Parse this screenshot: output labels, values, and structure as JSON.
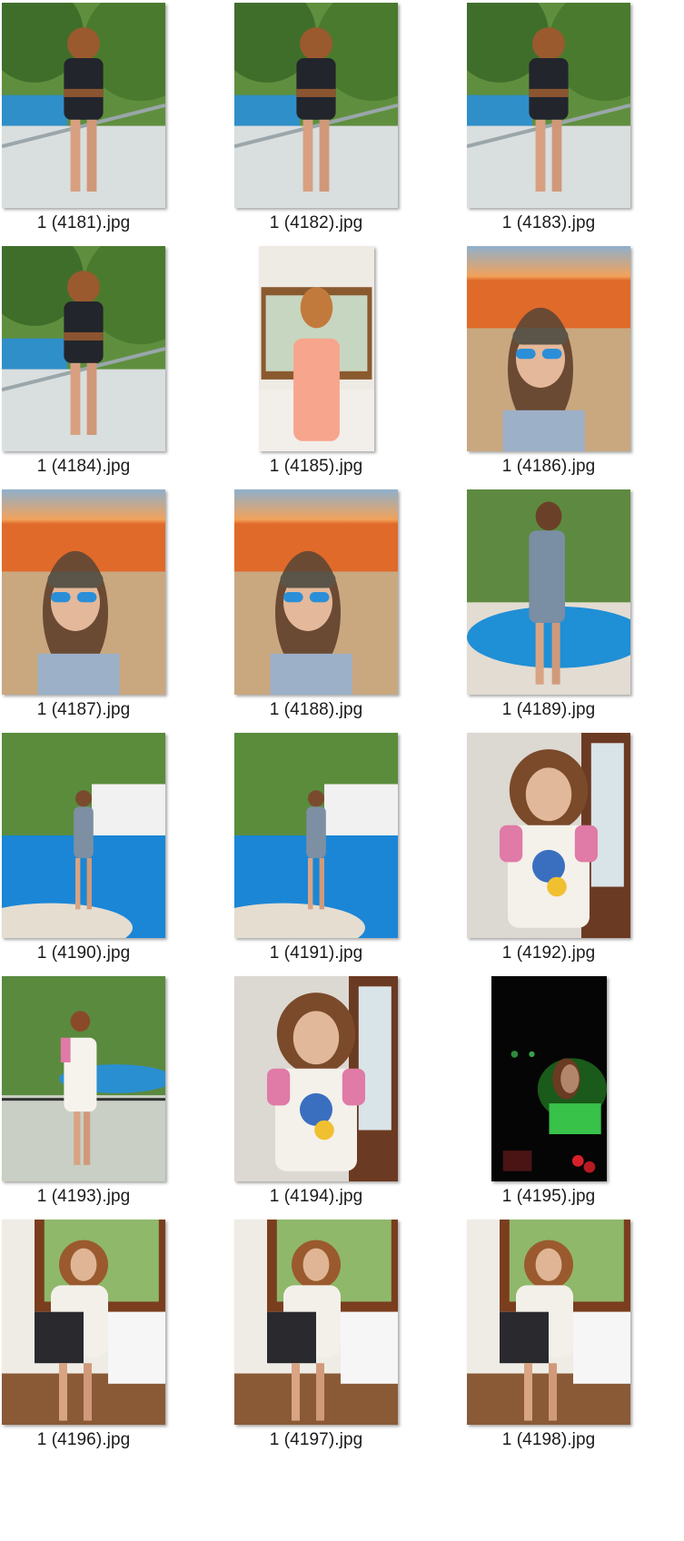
{
  "files": [
    {
      "name": "1 (4181).jpg",
      "scene": "pool-balcony"
    },
    {
      "name": "1 (4182).jpg",
      "scene": "pool-balcony"
    },
    {
      "name": "1 (4183).jpg",
      "scene": "pool-balcony"
    },
    {
      "name": "1 (4184).jpg",
      "scene": "pool-balcony"
    },
    {
      "name": "1 (4185).jpg",
      "scene": "window-room"
    },
    {
      "name": "1 (4186).jpg",
      "scene": "beach-sunset"
    },
    {
      "name": "1 (4187).jpg",
      "scene": "beach-sunset"
    },
    {
      "name": "1 (4188).jpg",
      "scene": "beach-sunset"
    },
    {
      "name": "1 (4189).jpg",
      "scene": "pool-garden"
    },
    {
      "name": "1 (4190).jpg",
      "scene": "pool-wide"
    },
    {
      "name": "1 (4191).jpg",
      "scene": "pool-wide"
    },
    {
      "name": "1 (4192).jpg",
      "scene": "indoor-closeup"
    },
    {
      "name": "1 (4193).jpg",
      "scene": "balcony-garden"
    },
    {
      "name": "1 (4194).jpg",
      "scene": "indoor-closeup"
    },
    {
      "name": "1 (4195).jpg",
      "scene": "night-neon"
    },
    {
      "name": "1 (4196).jpg",
      "scene": "office-window"
    },
    {
      "name": "1 (4197).jpg",
      "scene": "office-window"
    },
    {
      "name": "1 (4198).jpg",
      "scene": "office-window"
    }
  ],
  "colors": {
    "background": "#ffffff",
    "label_text": "#1a1a1a"
  }
}
